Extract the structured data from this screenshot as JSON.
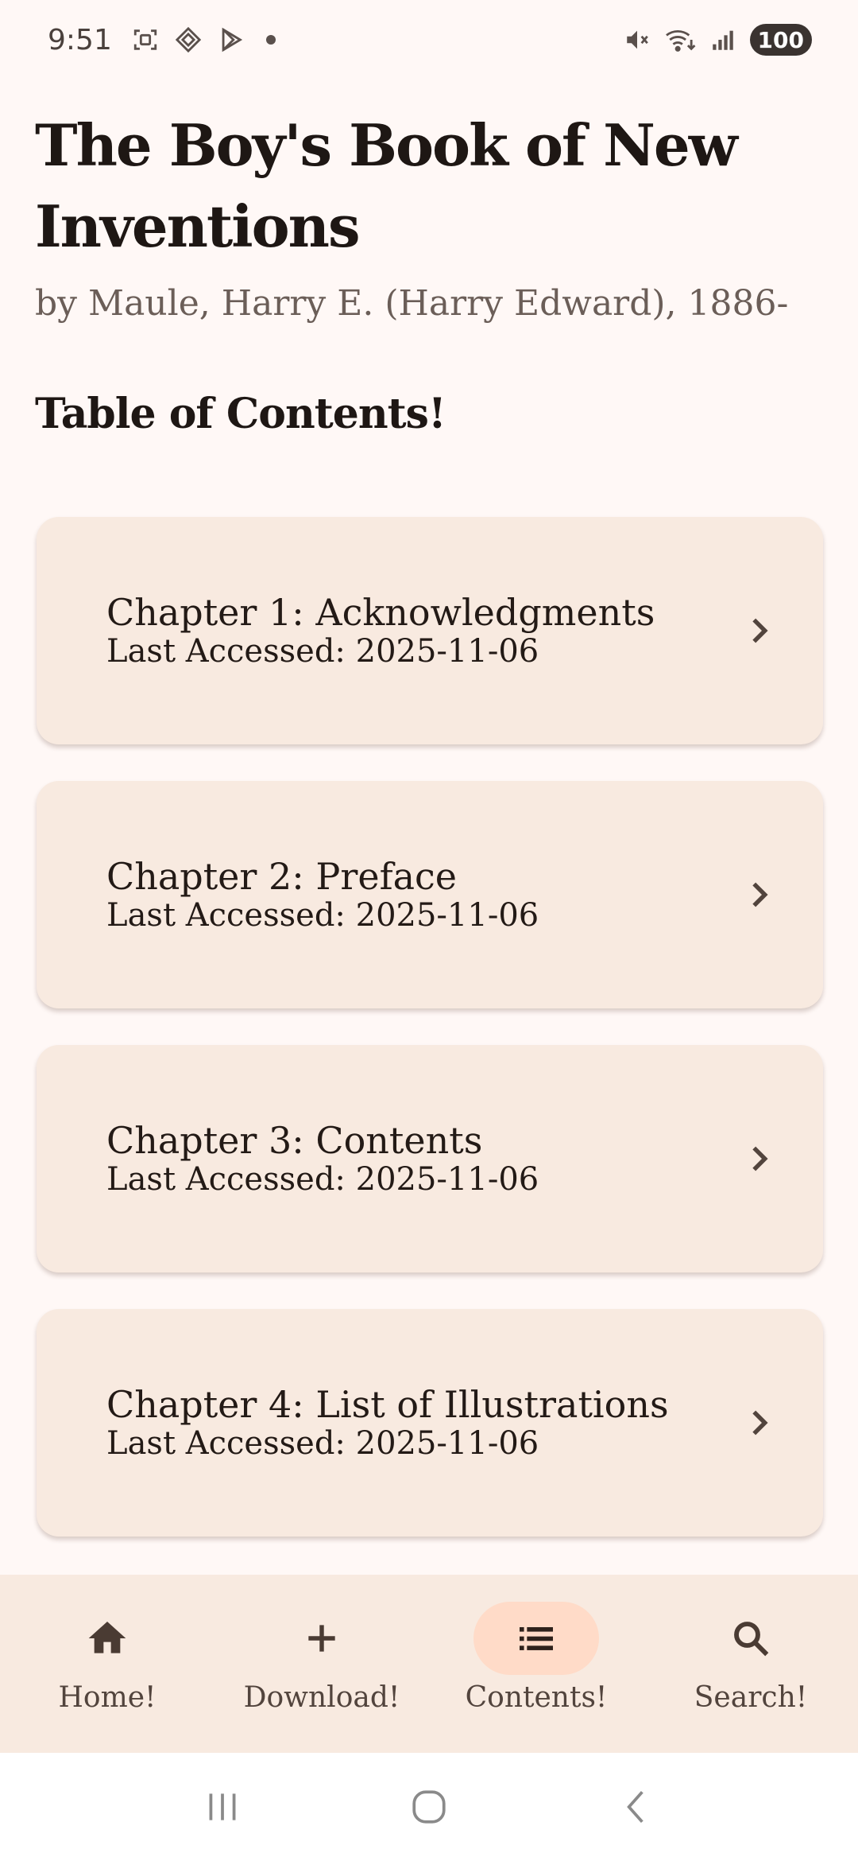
{
  "status_bar": {
    "time": "9:51",
    "battery": "100",
    "left_icons": [
      "screenshot-icon",
      "app-icon",
      "play-store-icon",
      "notification-dot"
    ],
    "right_icons": [
      "mute-icon",
      "wifi-icon",
      "signal-icon",
      "battery-icon"
    ]
  },
  "book": {
    "title": "The Boy's Book of New Inventions",
    "author": "by Maule, Harry E. (Harry Edward), 1886-"
  },
  "toc": {
    "heading": "Table of Contents!",
    "chapters": [
      {
        "title": "Chapter 1: Acknowledgments",
        "meta": "Last Accessed: 2025-11-06"
      },
      {
        "title": "Chapter 2: Preface",
        "meta": "Last Accessed: 2025-11-06"
      },
      {
        "title": "Chapter 3: Contents",
        "meta": "Last Accessed: 2025-11-06"
      },
      {
        "title": "Chapter 4: List of Illustrations",
        "meta": "Last Accessed: 2025-11-06"
      }
    ]
  },
  "bottom_nav": {
    "items": [
      {
        "label": "Home!",
        "icon": "home-icon",
        "active": false
      },
      {
        "label": "Download!",
        "icon": "plus-icon",
        "active": false
      },
      {
        "label": "Contents!",
        "icon": "list-icon",
        "active": true
      },
      {
        "label": "Search!",
        "icon": "search-icon",
        "active": false
      }
    ]
  },
  "system_nav": {
    "buttons": [
      "recents-icon",
      "home-circle-icon",
      "back-icon"
    ]
  },
  "colors": {
    "background": "#FFF8F6",
    "card": "#F8EAE0",
    "active_indicator": "#FFDBC8",
    "text": "#231A16",
    "muted_text": "#6B5E58"
  }
}
